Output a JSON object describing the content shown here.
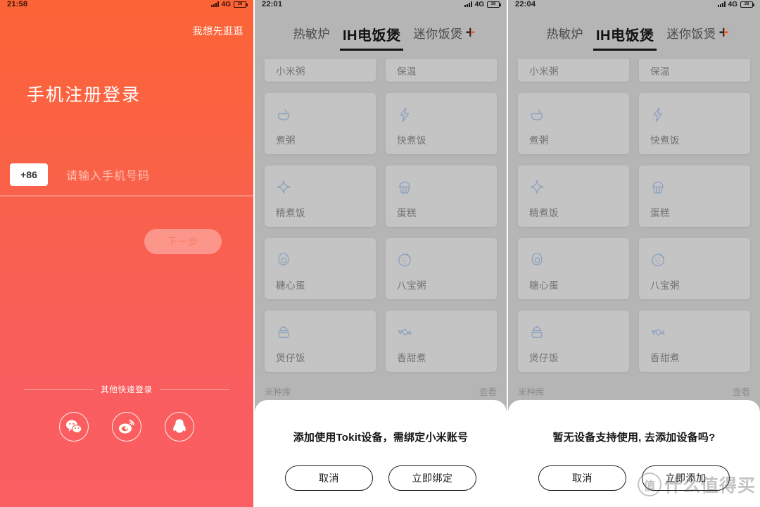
{
  "panels": {
    "login": {
      "status": {
        "time": "21:58",
        "network": "4G",
        "battery": "38"
      },
      "skip_label": "我想先逛逛",
      "title": "手机注册登录",
      "country_code": "+86",
      "phone_placeholder": "请输入手机号码",
      "phone_value": "",
      "next_label": "下一步",
      "other_login_label": "其他快速登录",
      "socials": [
        {
          "name": "wechat-icon",
          "label": "微信"
        },
        {
          "name": "weibo-icon",
          "label": "微博"
        },
        {
          "name": "qq-icon",
          "label": "QQ"
        }
      ],
      "colors": {
        "gradient_top": "#fb6436",
        "gradient_bottom": "#fb5f62",
        "button_text": "#fb7a63"
      }
    },
    "device_bind": {
      "status": {
        "time": "22:01",
        "network": "4G",
        "battery": "38"
      },
      "tabs": [
        {
          "label": "热敏炉",
          "active": false
        },
        {
          "label": "IH电饭煲",
          "active": true
        },
        {
          "label": "迷你饭煲",
          "active": false
        }
      ],
      "add_tab_icon": "plus-icon",
      "clipped_row": [
        {
          "label": "小米粥"
        },
        {
          "label": "保温"
        }
      ],
      "modes": [
        {
          "label": "煮粥",
          "icon": "bowl-icon"
        },
        {
          "label": "快煮饭",
          "icon": "lightning-icon"
        },
        {
          "label": "精煮饭",
          "icon": "sparkle-icon"
        },
        {
          "label": "蛋糕",
          "icon": "cupcake-icon"
        },
        {
          "label": "糖心蛋",
          "icon": "egg-icon"
        },
        {
          "label": "八宝粥",
          "icon": "porridge-circle-icon"
        },
        {
          "label": "煲仔饭",
          "icon": "pot-icon"
        },
        {
          "label": "香甜煮",
          "icon": "candy-icon"
        }
      ],
      "rice_library": {
        "label": "米种库",
        "action": "查看"
      },
      "dialog": {
        "message": "添加使用Tokit设备，需绑定小米账号",
        "cancel": "取消",
        "confirm": "立即绑定"
      },
      "colors": {
        "page_bg": "#b5b5b5",
        "card_bg": "#c4c4c4",
        "icon": "#8fa3bd",
        "accent": "#ea5a2d"
      }
    },
    "device_add": {
      "status": {
        "time": "22:04",
        "network": "4G",
        "battery": "38"
      },
      "tabs": [
        {
          "label": "热敏炉",
          "active": false
        },
        {
          "label": "IH电饭煲",
          "active": true
        },
        {
          "label": "迷你饭煲",
          "active": false
        }
      ],
      "add_tab_icon": "plus-icon",
      "clipped_row": [
        {
          "label": "小米粥"
        },
        {
          "label": "保温"
        }
      ],
      "modes": [
        {
          "label": "煮粥",
          "icon": "bowl-icon"
        },
        {
          "label": "快煮饭",
          "icon": "lightning-icon"
        },
        {
          "label": "精煮饭",
          "icon": "sparkle-icon"
        },
        {
          "label": "蛋糕",
          "icon": "cupcake-icon"
        },
        {
          "label": "糖心蛋",
          "icon": "egg-icon"
        },
        {
          "label": "八宝粥",
          "icon": "porridge-circle-icon"
        },
        {
          "label": "煲仔饭",
          "icon": "pot-icon"
        },
        {
          "label": "香甜煮",
          "icon": "candy-icon"
        }
      ],
      "rice_library": {
        "label": "米种库",
        "action": "查看"
      },
      "dialog": {
        "message": "暂无设备支持使用, 去添加设备吗?",
        "cancel": "取消",
        "confirm": "立即添加"
      }
    }
  },
  "watermark": {
    "mark": "值",
    "text": "什么值得买"
  }
}
